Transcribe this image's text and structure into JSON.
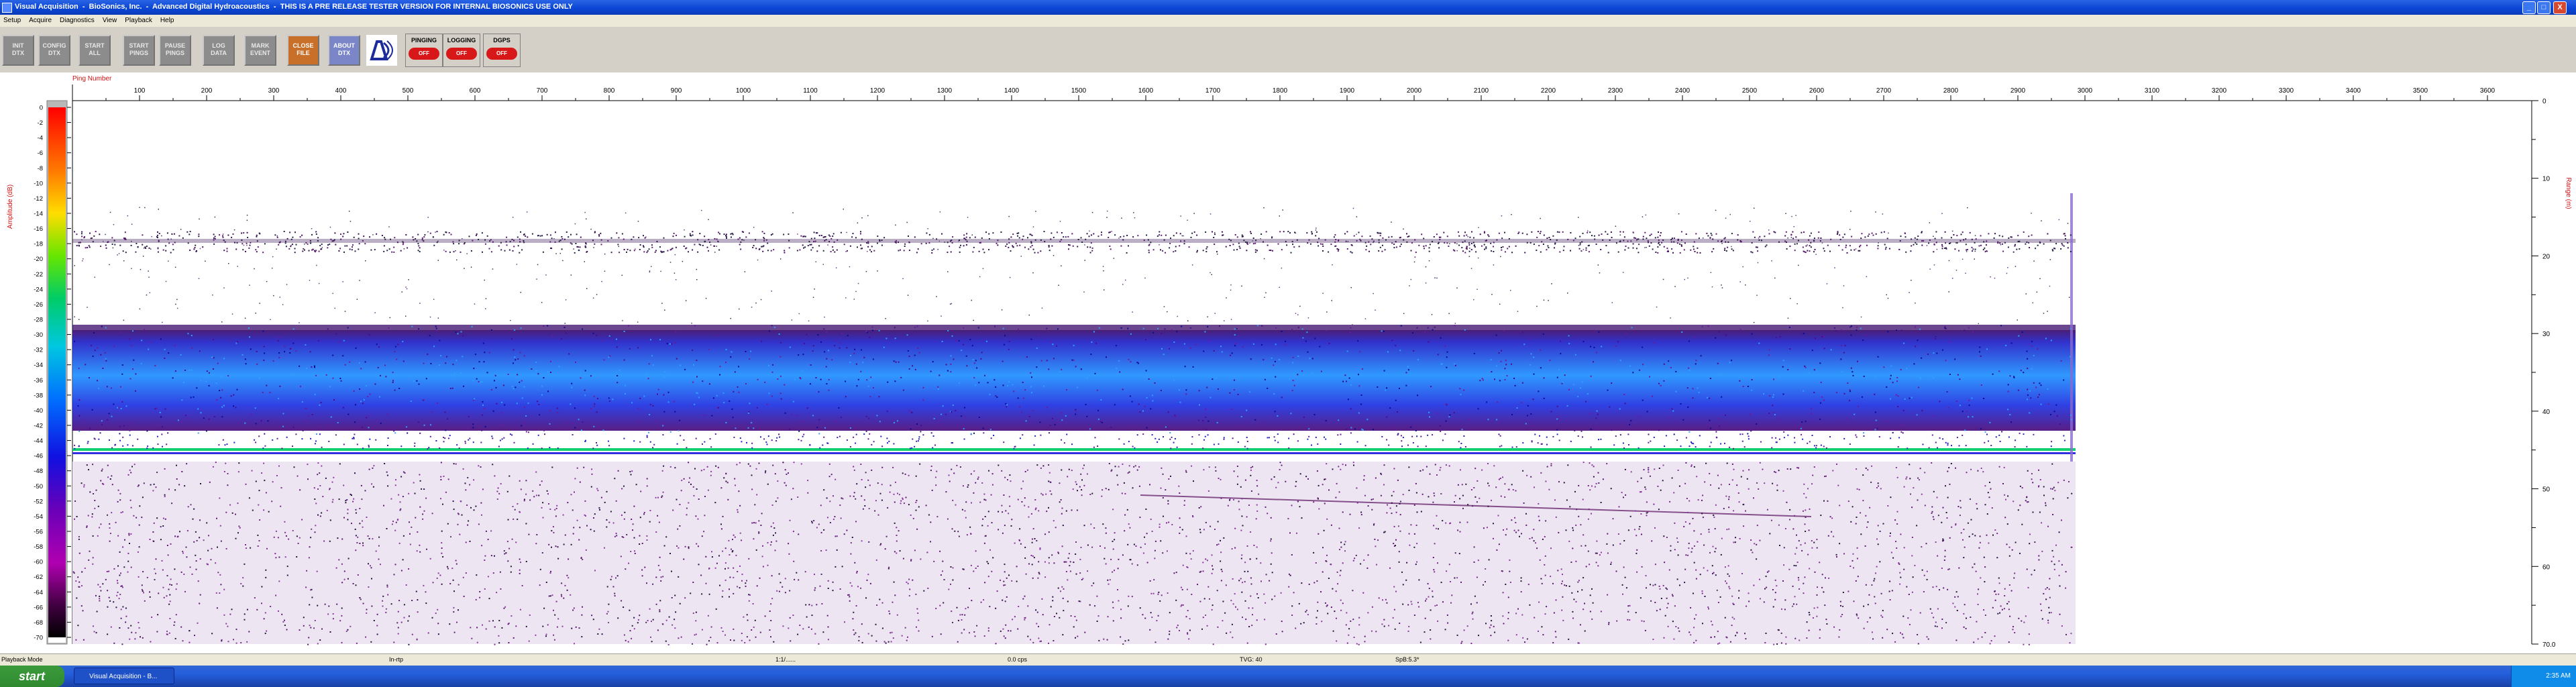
{
  "window": {
    "title": "Visual Acquisition  -  BioSonics, Inc.  -  Advanced Digital Hydroacoustics  -  THIS IS A PRE RELEASE TESTER VERSION FOR INTERNAL BIOSONICS USE ONLY",
    "min_label": "_",
    "max_label": "□",
    "close_label": "X"
  },
  "menu": [
    "Setup",
    "Acquire",
    "Diagnostics",
    "View",
    "Playback",
    "Help"
  ],
  "toolbar": {
    "buttons": [
      {
        "line1": "INIT",
        "line2": "DTX"
      },
      {
        "line1": "CONFIG",
        "line2": "DTX"
      },
      {
        "line1": "START",
        "line2": "ALL"
      },
      {
        "line1": "START",
        "line2": "PINGS"
      },
      {
        "line1": "PAUSE",
        "line2": "PINGS"
      },
      {
        "line1": "LOG",
        "line2": "DATA"
      },
      {
        "line1": "MARK",
        "line2": "EVENT"
      },
      {
        "line1": "CLOSE",
        "line2": "FILE"
      },
      {
        "line1": "ABOUT",
        "line2": "DTX"
      }
    ],
    "status": [
      {
        "label": "PINGING",
        "state": "OFF"
      },
      {
        "label": "LOGGING",
        "state": "OFF"
      },
      {
        "label": "DGPS",
        "state": "OFF"
      }
    ]
  },
  "plot": {
    "x_axis_label": "Ping Number",
    "x_ticks": [
      "100",
      "200",
      "300",
      "400",
      "500",
      "600",
      "700",
      "800",
      "900",
      "1000",
      "1100",
      "1200",
      "1300",
      "1400",
      "1500",
      "1600",
      "1700",
      "1800",
      "1900",
      "2000",
      "2100",
      "2200",
      "2300",
      "2400",
      "2500",
      "2600",
      "2700",
      "2800",
      "2900",
      "3000",
      "3100",
      "3200",
      "3300",
      "3400",
      "3500",
      "3600"
    ],
    "amplitude_label": "Amplitude (dB)",
    "amplitude_ticks": [
      "0",
      "-2",
      "-4",
      "-6",
      "-8",
      "-10",
      "-12",
      "-14",
      "-16",
      "-18",
      "-20",
      "-22",
      "-24",
      "-26",
      "-28",
      "-30",
      "-32",
      "-34",
      "-36",
      "-38",
      "-40",
      "-42",
      "-44",
      "-46",
      "-48",
      "-50",
      "-52",
      "-54",
      "-56",
      "-58",
      "-60",
      "-62",
      "-64",
      "-66",
      "-68",
      "-70"
    ],
    "range_label": "Range (m)",
    "range_ticks": [
      "0",
      "10",
      "20",
      "30",
      "40",
      "50",
      "60",
      "70.0"
    ]
  },
  "chart_data": {
    "type": "heatmap",
    "x_range": [
      0,
      3700
    ],
    "y_range_m": [
      0,
      70
    ],
    "amplitude_range_db": [
      -70,
      0
    ],
    "pings_recorded": 2980,
    "features": [
      {
        "name": "surface noise band",
        "range_m": [
          19,
          22
        ]
      },
      {
        "name": "dense layer",
        "range_m": [
          31,
          44
        ]
      },
      {
        "name": "bottom line",
        "range_m": [
          44.8,
          45.6
        ]
      },
      {
        "name": "sub-bottom scatter",
        "range_m": [
          46,
          70
        ]
      }
    ]
  },
  "statusbar": {
    "mode": "Playback Mode",
    "rate": "In-rtp",
    "field3": "1:1/......",
    "cps": "0.0 cps",
    "tvg": "TVG: 40",
    "spb": "SpB:5.3*"
  },
  "taskbar": {
    "start_label": "start",
    "task_label": "Visual Acquisition - B...",
    "clock": "2:35 AM"
  },
  "colors": {
    "titlebar": "#0b46d6",
    "plot_axis_text": "#d01010",
    "layer_blue": "#2a34e0",
    "bottom_green": "#10d070"
  }
}
